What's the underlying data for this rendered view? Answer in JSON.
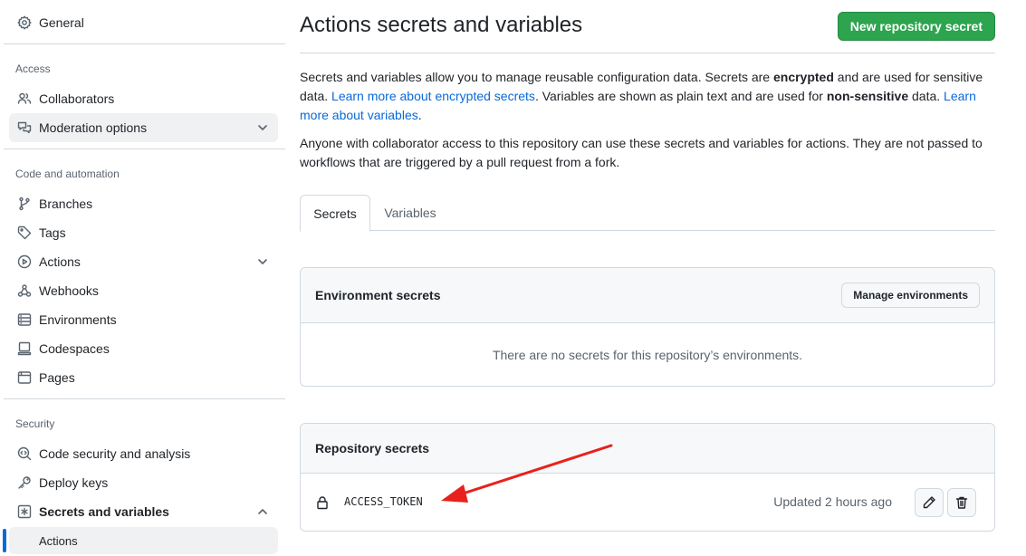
{
  "sidebar": {
    "top_item": {
      "label": "General",
      "icon": "gear-icon"
    },
    "sections": [
      {
        "heading": "Access",
        "items": [
          {
            "label": "Collaborators",
            "icon": "people-icon"
          },
          {
            "label": "Moderation options",
            "icon": "comment-discussion-icon",
            "expandable": true
          }
        ]
      },
      {
        "heading": "Code and automation",
        "items": [
          {
            "label": "Branches",
            "icon": "git-branch-icon"
          },
          {
            "label": "Tags",
            "icon": "tag-icon"
          },
          {
            "label": "Actions",
            "icon": "play-icon",
            "expandable": true
          },
          {
            "label": "Webhooks",
            "icon": "webhook-icon"
          },
          {
            "label": "Environments",
            "icon": "server-icon"
          },
          {
            "label": "Codespaces",
            "icon": "codespaces-icon"
          },
          {
            "label": "Pages",
            "icon": "browser-icon"
          }
        ]
      },
      {
        "heading": "Security",
        "items": [
          {
            "label": "Code security and analysis",
            "icon": "codescan-icon"
          },
          {
            "label": "Deploy keys",
            "icon": "key-icon"
          },
          {
            "label": "Secrets and variables",
            "icon": "asterisk-icon",
            "expanded": true
          }
        ]
      }
    ],
    "sub_item": {
      "label": "Actions"
    }
  },
  "main": {
    "title": "Actions secrets and variables",
    "new_secret_button": "New repository secret",
    "desc1": {
      "t1": "Secrets and variables allow you to manage reusable configuration data. Secrets are ",
      "b1": "encrypted",
      "t2": " and are used for sensitive data. ",
      "link1": "Learn more about encrypted secrets",
      "t3": ". Variables are shown as plain text and are used for ",
      "b2": "non-sensitive",
      "t4": " data. ",
      "link2": "Learn more about variables",
      "t5": "."
    },
    "desc2": "Anyone with collaborator access to this repository can use these secrets and variables for actions. They are not passed to workflows that are triggered by a pull request from a fork.",
    "tabs": [
      {
        "label": "Secrets",
        "active": true
      },
      {
        "label": "Variables",
        "active": false
      }
    ],
    "env_secrets": {
      "heading": "Environment secrets",
      "manage_button": "Manage environments",
      "empty": "There are no secrets for this repository’s environments."
    },
    "repo_secrets": {
      "heading": "Repository secrets",
      "items": [
        {
          "name": "ACCESS_TOKEN",
          "updated": "Updated 2 hours ago"
        }
      ]
    }
  },
  "colors": {
    "accent": "#0969da",
    "primary_button": "#2da44e",
    "annotation_arrow": "#e8211c"
  }
}
